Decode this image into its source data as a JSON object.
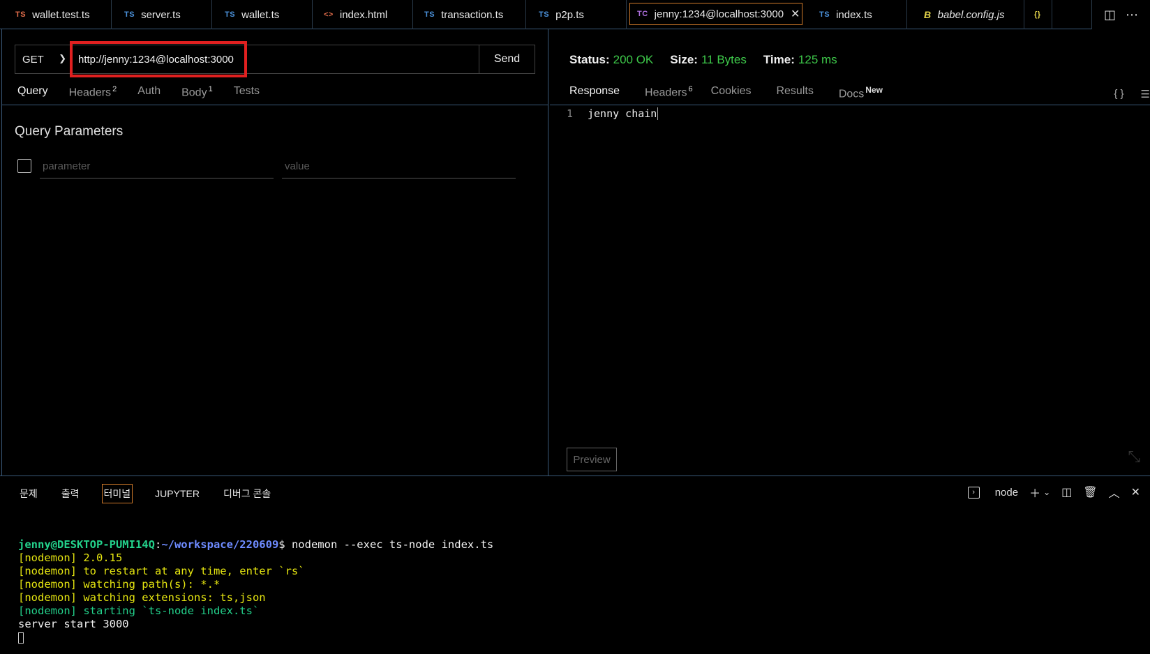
{
  "tabs": [
    {
      "icon": "TS",
      "icon_color": "#e06c4a",
      "label": "wallet.test.ts"
    },
    {
      "icon": "TS",
      "icon_color": "#4a90d9",
      "label": "server.ts"
    },
    {
      "icon": "TS",
      "icon_color": "#4a90d9",
      "label": "wallet.ts"
    },
    {
      "icon": "<>",
      "icon_color": "#e06c4a",
      "label": "index.html"
    },
    {
      "icon": "TS",
      "icon_color": "#4a90d9",
      "label": "transaction.ts"
    },
    {
      "icon": "TS",
      "icon_color": "#4a90d9",
      "label": "p2p.ts"
    },
    {
      "icon": "TC",
      "icon_color": "#b070e0",
      "label": "jenny:1234@localhost:3000",
      "close": "✕"
    },
    {
      "icon": "TS",
      "icon_color": "#4a90d9",
      "label": "index.ts"
    },
    {
      "icon": "B",
      "icon_color": "#e5d54a",
      "label": "babel.config.js"
    },
    {
      "icon": "{}",
      "icon_color": "#e5d54a",
      "label": ""
    }
  ],
  "request": {
    "method": "GET",
    "url": "http://jenny:1234@localhost:3000",
    "send_label": "Send",
    "tabs": [
      {
        "label": "Query",
        "badge": ""
      },
      {
        "label": "Headers",
        "badge": "2"
      },
      {
        "label": "Auth",
        "badge": ""
      },
      {
        "label": "Body",
        "badge": "1"
      },
      {
        "label": "Tests",
        "badge": ""
      }
    ],
    "query_title": "Query Parameters",
    "param_placeholder": "parameter",
    "value_placeholder": "value"
  },
  "response": {
    "status_label": "Status:",
    "status_value": "200 OK",
    "size_label": "Size:",
    "size_value": "11 Bytes",
    "time_label": "Time:",
    "time_value": "125 ms",
    "tabs": [
      {
        "label": "Response",
        "badge": ""
      },
      {
        "label": "Headers",
        "badge": "6"
      },
      {
        "label": "Cookies",
        "badge": ""
      },
      {
        "label": "Results",
        "badge": ""
      },
      {
        "label": "Docs",
        "badge": "New"
      }
    ],
    "line_number": "1",
    "body": "jenny chain",
    "preview_label": "Preview",
    "format_icon": "{ }"
  },
  "panel": {
    "tabs": [
      "문제",
      "출력",
      "터미널",
      "JUPYTER",
      "디버그 콘솔"
    ],
    "terminal_name": "node"
  },
  "terminal": {
    "user": "jenny@DESKTOP-PUMI14Q",
    "path": "~/workspace/220609",
    "command": "$ nodemon --exec ts-node index.ts",
    "lines": [
      "[nodemon] 2.0.15",
      "[nodemon] to restart at any time, enter `rs`",
      "[nodemon] watching path(s): *.*",
      "[nodemon] watching extensions: ts,json",
      "[nodemon] starting `ts-node index.ts`",
      "server start 3000"
    ]
  }
}
